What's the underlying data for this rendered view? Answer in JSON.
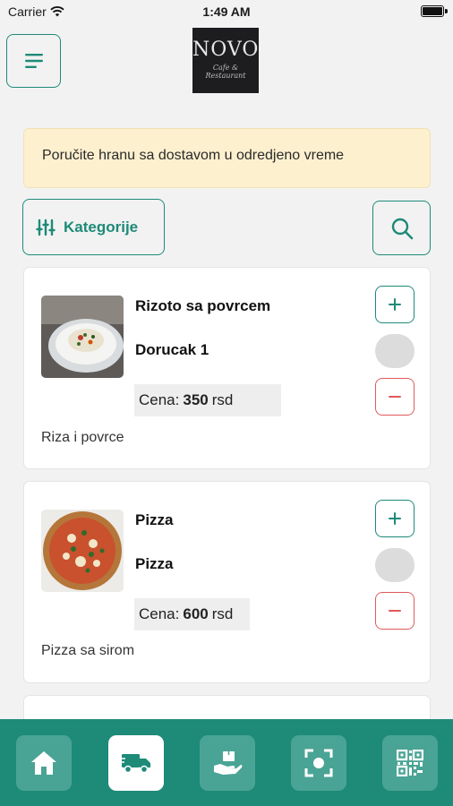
{
  "status_bar": {
    "carrier": "Carrier",
    "time": "1:49 AM"
  },
  "header": {
    "logo_main": "NOVO",
    "logo_sub": "Cafe & Restaurant"
  },
  "notice": {
    "text": "Poručite hranu sa dostavom u odredjeno vreme"
  },
  "toolbar": {
    "category_label": "Kategorije"
  },
  "products": [
    {
      "name": "Rizoto sa povrcem",
      "subtitle": "Dorucak 1",
      "price_prefix": "Cena:",
      "price": "350",
      "currency": "rsd",
      "description": "Riza i povrce"
    },
    {
      "name": "Pizza",
      "subtitle": "Pizza",
      "price_prefix": "Cena:",
      "price": "600",
      "currency": "rsd",
      "description": "Pizza sa sirom"
    }
  ],
  "bottom_nav": {
    "items": [
      {
        "icon": "home-icon",
        "active": false
      },
      {
        "icon": "delivery-truck-icon",
        "active": true
      },
      {
        "icon": "hand-package-icon",
        "active": false
      },
      {
        "icon": "scan-icon",
        "active": false
      },
      {
        "icon": "qr-code-icon",
        "active": false
      }
    ]
  },
  "colors": {
    "accent": "#1e8a78",
    "danger": "#e05a5a",
    "notice_bg": "#fdf0cf",
    "nav_bg": "#1e8a78"
  }
}
